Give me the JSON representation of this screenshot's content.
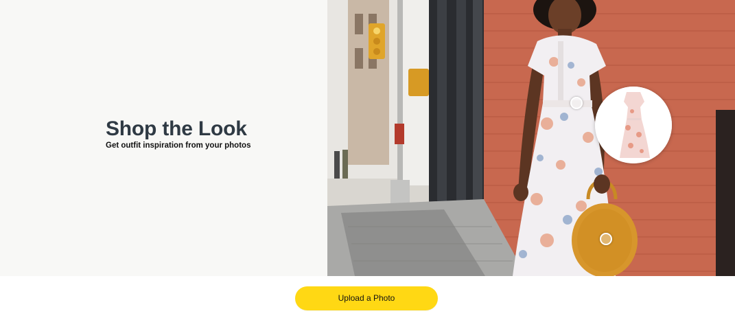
{
  "hero": {
    "title": "Shop the Look",
    "subtitle": "Get outfit inspiration from your photos"
  },
  "actions": {
    "upload_label": "Upload a Photo"
  },
  "colors": {
    "upload_button": "#ffd814",
    "left_panel_bg": "#f8f8f6",
    "title_text": "#2f3a44",
    "brick_wall": "#c8684f"
  },
  "icons": {
    "dress_hotspot": "hotspot-circle",
    "bag_hotspot": "hotspot-circle",
    "dress_preview": "dress-thumbnail"
  }
}
